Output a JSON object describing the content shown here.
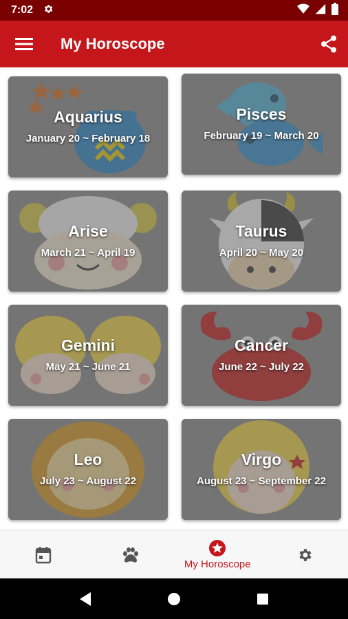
{
  "status_bar": {
    "time": "7:02"
  },
  "app_bar": {
    "title": "My Horoscope"
  },
  "signs": [
    {
      "name": "Aquarius",
      "dates": "January 20 ~ February 18"
    },
    {
      "name": "Pisces",
      "dates": "February 19 ~ March 20"
    },
    {
      "name": "Arise",
      "dates": "March 21 ~ April 19"
    },
    {
      "name": "Taurus",
      "dates": "April 20 ~ May 20"
    },
    {
      "name": "Gemini",
      "dates": "May 21 ~ June 21"
    },
    {
      "name": "Cancer",
      "dates": "June 22 ~ July 22"
    },
    {
      "name": "Leo",
      "dates": "July 23 ~ August 22"
    },
    {
      "name": "Virgo",
      "dates": "August 23 ~ September 22"
    }
  ],
  "bottom_nav": {
    "items": [
      {
        "icon": "calendar-icon",
        "label": "",
        "active": false
      },
      {
        "icon": "paw-icon",
        "label": "",
        "active": false
      },
      {
        "icon": "star-icon",
        "label": "My Horoscope",
        "active": true
      },
      {
        "icon": "gear-icon",
        "label": "",
        "active": false
      }
    ]
  },
  "colors": {
    "status_bar": "#7a0000",
    "app_bar": "#c4161b",
    "accent": "#c4161b",
    "card_overlay": "#5f5f5f"
  }
}
